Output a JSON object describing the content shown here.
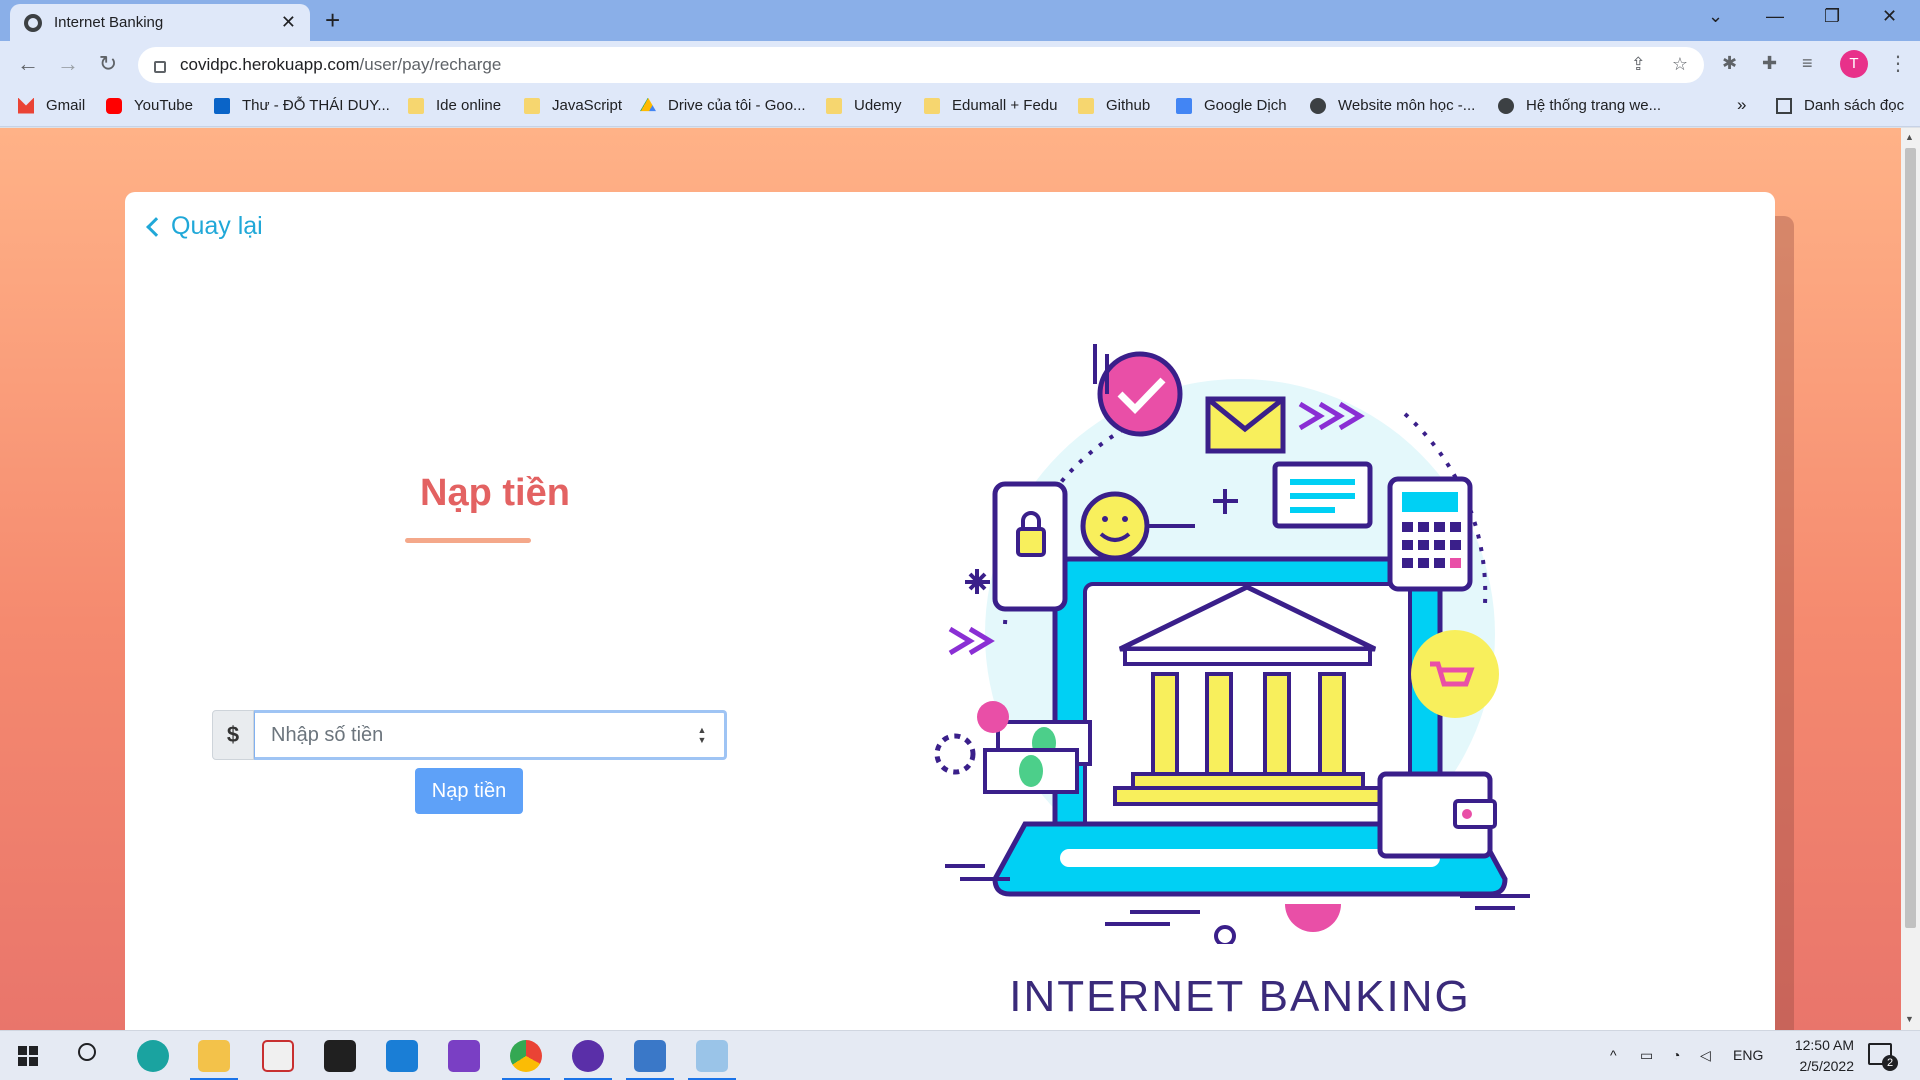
{
  "browser": {
    "tab_title": "Internet Banking",
    "url_host": "covidpc.herokuapp.com",
    "url_path": "/user/pay/recharge",
    "profile_initial": "T"
  },
  "bookmarks": {
    "items": [
      {
        "label": "Gmail",
        "icon": "gmail-icon"
      },
      {
        "label": "YouTube",
        "icon": "youtube-icon"
      },
      {
        "label": "Thư - ĐỖ THÁI DUY...",
        "icon": "outlook-icon"
      },
      {
        "label": "Ide online",
        "icon": "folder-icon"
      },
      {
        "label": "JavaScript",
        "icon": "folder-icon"
      },
      {
        "label": "Drive của tôi - Goo...",
        "icon": "drive-icon"
      },
      {
        "label": "Udemy",
        "icon": "folder-icon"
      },
      {
        "label": "Edumall + Fedu",
        "icon": "folder-icon"
      },
      {
        "label": "Github",
        "icon": "folder-icon"
      },
      {
        "label": "Google Dịch",
        "icon": "translate-icon"
      },
      {
        "label": "Website môn học -...",
        "icon": "globe-icon"
      },
      {
        "label": "Hệ thống trang we...",
        "icon": "globe-icon"
      }
    ],
    "more": "»",
    "reading_list": "Danh sách đọc"
  },
  "page": {
    "back_label": "Quay lại",
    "heading": "Nạp tiền",
    "currency_symbol": "$",
    "amount_placeholder": "Nhập số tiền",
    "submit_label": "Nạp tiền",
    "brand_text": "INTERNET BANKING"
  },
  "taskbar": {
    "language": "ENG",
    "time": "12:50 AM",
    "date": "2/5/2022",
    "notification_count": "2"
  },
  "colors": {
    "accent_link": "#20a8d8",
    "heading": "#e36262",
    "button": "#5ea1f8",
    "background_top": "#ffb287",
    "background_bottom": "#e9756b"
  }
}
